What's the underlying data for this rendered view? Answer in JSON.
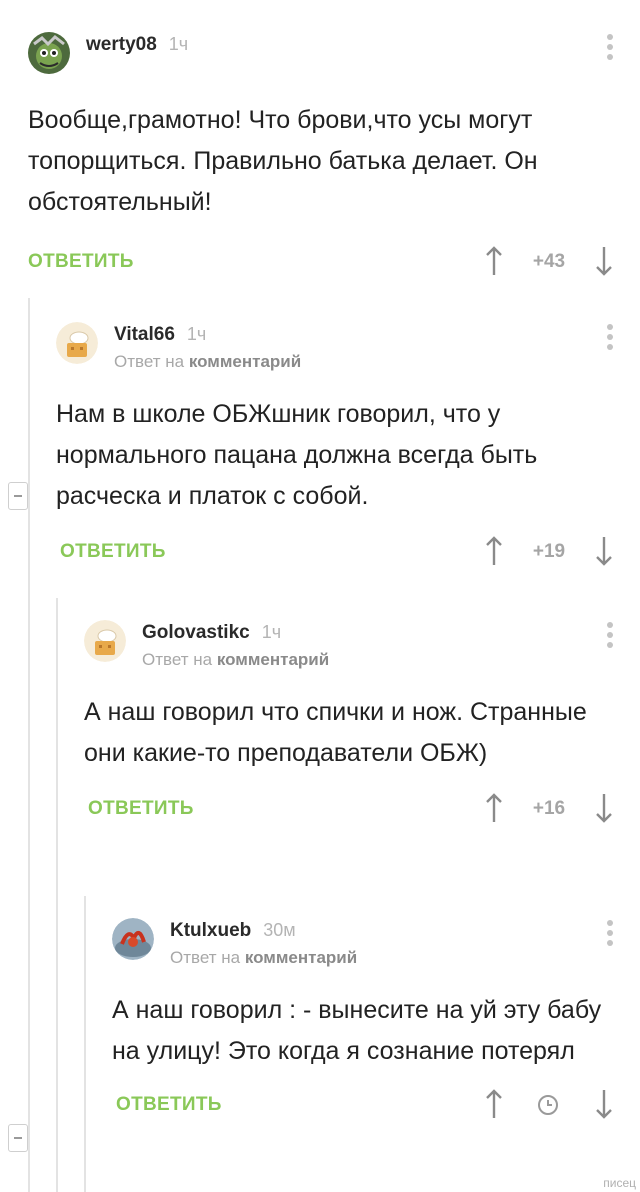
{
  "comments": [
    {
      "username": "werty08",
      "time": "1ч",
      "text": "Вообще,грамотно! Что брови,что усы могут топорщиться. Правильно батька делает. Он обстоятельный!",
      "reply_label": "ОТВЕТИТЬ",
      "score": "+43"
    },
    {
      "username": "Vital66",
      "time": "1ч",
      "reply_prefix": "Ответ на",
      "reply_target": "комментарий",
      "text": "Нам в школе ОБЖшник говорил, что у нормального пацана должна всегда быть расческа и платок с собой.",
      "reply_label": "ОТВЕТИТЬ",
      "score": "+19"
    },
    {
      "username": "Golovastikc",
      "time": "1ч",
      "reply_prefix": "Ответ на",
      "reply_target": "комментарий",
      "text": "А наш говорил что спички и нож. Странные они какие-то преподаватели ОБЖ)",
      "reply_label": "ОТВЕТИТЬ",
      "score": "+16"
    },
    {
      "username": "Ktulxueb",
      "time": "30м",
      "reply_prefix": "Ответ на",
      "reply_target": "комментарий",
      "text": "А наш говорил : - вынесите на уй эту бабу на улицу! Это когда я сознание потерял",
      "reply_label": "ОТВЕТИТЬ",
      "score_icon": "clock-icon"
    }
  ],
  "watermark": "писец",
  "colors": {
    "accent_green": "#8ac858",
    "muted": "#a5a5a5",
    "thread_line": "#e3e3e3"
  }
}
